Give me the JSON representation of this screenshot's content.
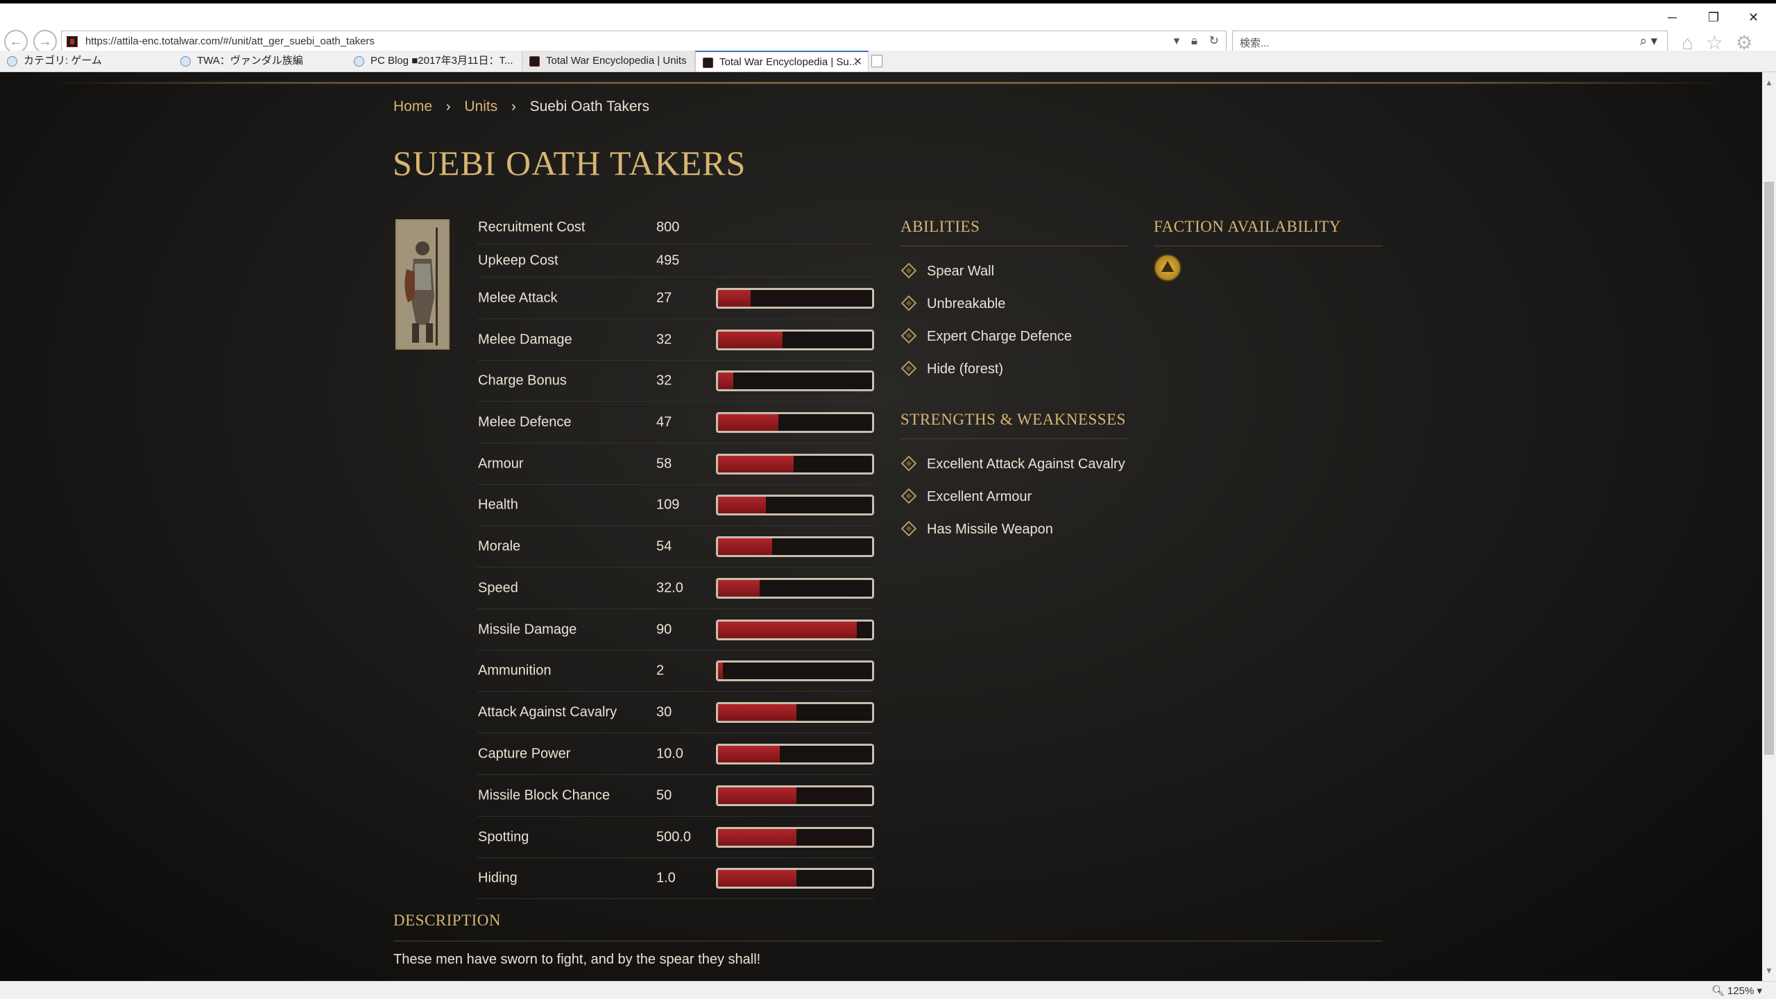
{
  "browser": {
    "url": "https://attila-enc.totalwar.com/#/unit/att_ger_suebi_oath_takers",
    "search_placeholder": "検索...",
    "tabs": [
      {
        "label": "カテゴリ: ゲーム"
      },
      {
        "label": "TWA：ヴァンダル族編"
      },
      {
        "label": "PC Blog ■2017年3月11日：T..."
      },
      {
        "label": "Total War Encyclopedia | Units"
      },
      {
        "label": "Total War Encyclopedia | Su..."
      }
    ],
    "zoom": "125%"
  },
  "breadcrumb": {
    "home": "Home",
    "units": "Units",
    "current": "Suebi Oath Takers"
  },
  "unit": {
    "name": "SUEBI OATH TAKERS",
    "stats": [
      {
        "label": "Recruitment Cost",
        "value": "800"
      },
      {
        "label": "Upkeep Cost",
        "value": "495"
      },
      {
        "label": "Melee Attack",
        "value": "27",
        "level": 0.21
      },
      {
        "label": "Melee Damage",
        "value": "32",
        "level": 0.42
      },
      {
        "label": "Charge Bonus",
        "value": "32",
        "level": 0.1
      },
      {
        "label": "Melee Defence",
        "value": "47",
        "level": 0.39
      },
      {
        "label": "Armour",
        "value": "58",
        "level": 0.49
      },
      {
        "label": "Health",
        "value": "109",
        "level": 0.31
      },
      {
        "label": "Morale",
        "value": "54",
        "level": 0.35
      },
      {
        "label": "Speed",
        "value": "32.0",
        "level": 0.27
      },
      {
        "label": "Missile Damage",
        "value": "90",
        "level": 0.9
      },
      {
        "label": "Ammunition",
        "value": "2",
        "level": 0.03
      },
      {
        "label": "Attack Against Cavalry",
        "value": "30",
        "level": 0.51
      },
      {
        "label": "Capture Power",
        "value": "10.0",
        "level": 0.4
      },
      {
        "label": "Missile Block Chance",
        "value": "50",
        "level": 0.51
      },
      {
        "label": "Spotting",
        "value": "500.0",
        "level": 0.51
      },
      {
        "label": "Hiding",
        "value": "1.0",
        "level": 0.51
      }
    ]
  },
  "abilities": {
    "title": "ABILITIES",
    "items": [
      "Spear Wall",
      "Unbreakable",
      "Expert Charge Defence",
      "Hide (forest)"
    ]
  },
  "strengths": {
    "title": "STRENGTHS & WEAKNESSES",
    "items": [
      "Excellent Attack Against Cavalry",
      "Excellent Armour",
      "Has Missile Weapon"
    ]
  },
  "faction": {
    "title": "FACTION AVAILABILITY",
    "icon": "suebi-faction-emblem-icon"
  },
  "description": {
    "title": "DESCRIPTION",
    "text": "These men have sworn to fight, and by the spear they shall!"
  },
  "colors": {
    "accent_gold": "#d7b673",
    "bar_fill": "#a0202a",
    "background": "#1b1917"
  }
}
